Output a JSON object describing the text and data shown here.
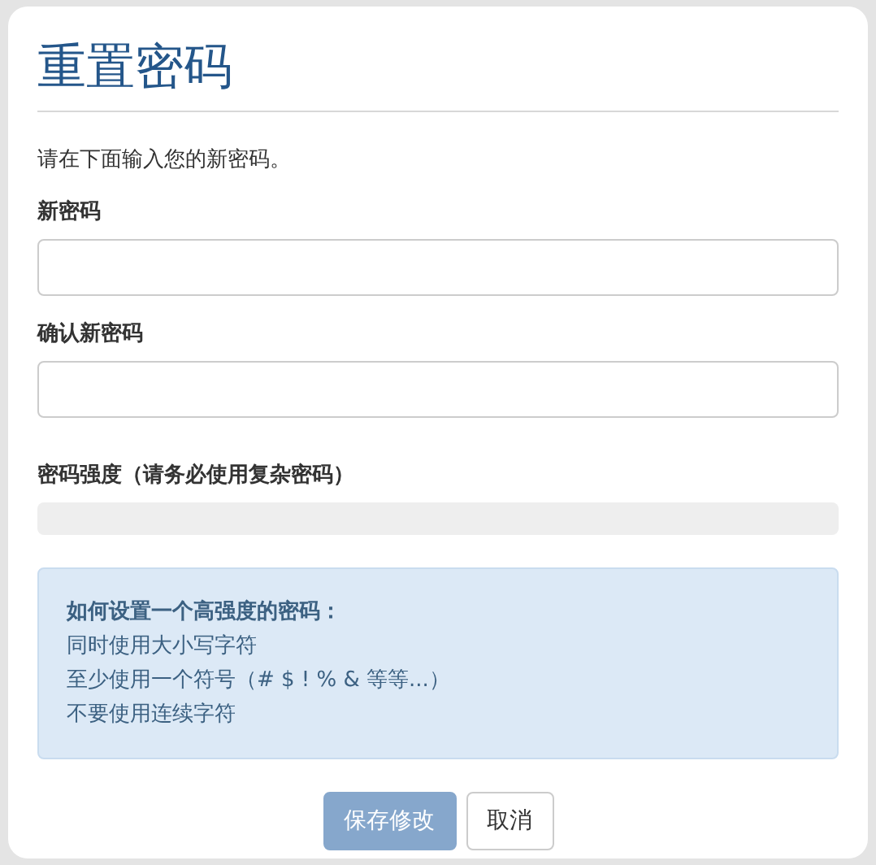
{
  "title": "重置密码",
  "intro": "请在下面输入您的新密码。",
  "fields": [
    {
      "label": "新密码"
    },
    {
      "label": "确认新密码"
    }
  ],
  "strength": {
    "label": "密码强度（请务必使用复杂密码）",
    "level": 0
  },
  "tips": {
    "heading": "如何设置一个高强度的密码：",
    "items": [
      "同时使用大小写字符",
      "至少使用一个符号（# $ ! % & 等等...）",
      "不要使用连续字符"
    ]
  },
  "buttons": [
    {
      "label": "保存修改",
      "kind": "primary",
      "disabled": true
    },
    {
      "label": "取消",
      "kind": "default",
      "disabled": false
    }
  ]
}
